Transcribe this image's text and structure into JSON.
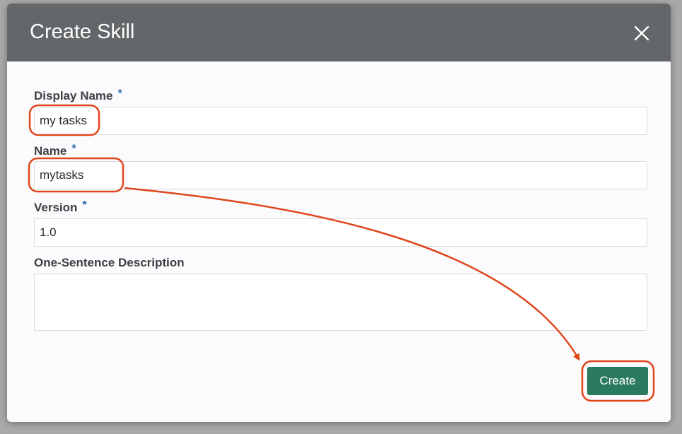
{
  "dialog": {
    "title": "Create Skill",
    "close_icon": "close-icon"
  },
  "form": {
    "display_name": {
      "label": "Display Name",
      "required_mark": "*",
      "value": "my tasks"
    },
    "name": {
      "label": "Name",
      "required_mark": "*",
      "value": "mytasks"
    },
    "version": {
      "label": "Version",
      "required_mark": "*",
      "value": "1.0"
    },
    "description": {
      "label": "One-Sentence Description",
      "value": ""
    }
  },
  "actions": {
    "create_label": "Create"
  },
  "colors": {
    "header_bg": "#646769",
    "create_bg": "#2a7a5e",
    "required_mark": "#2f6fae",
    "annotation": "#e0461c"
  }
}
